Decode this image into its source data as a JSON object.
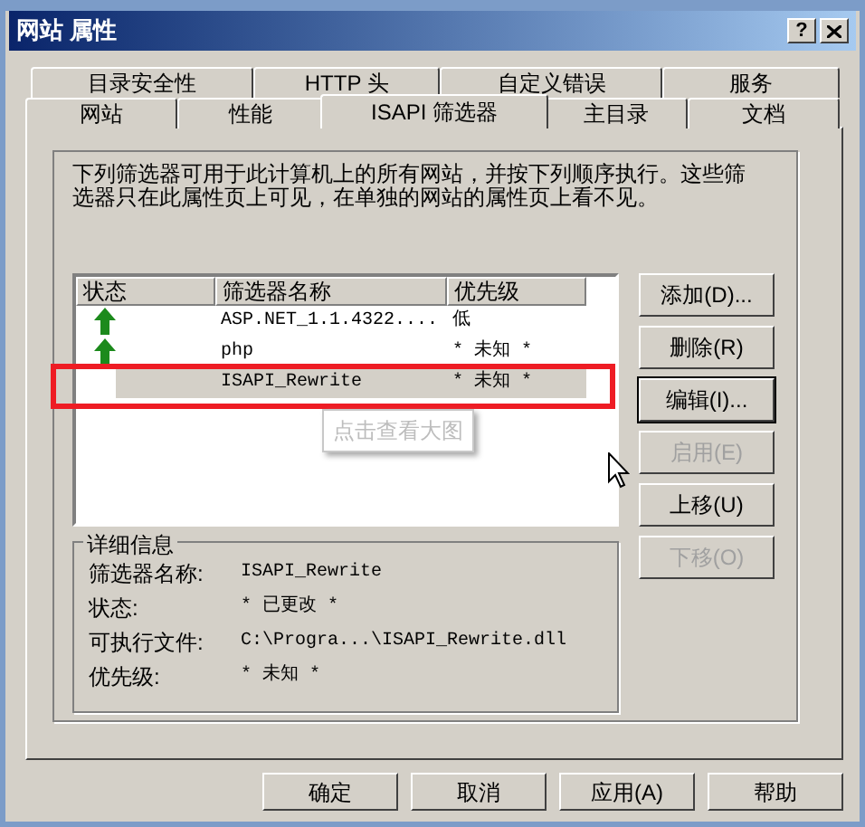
{
  "window": {
    "title": "网站 属性",
    "help_button": "?"
  },
  "tabs_back": [
    {
      "label": "目录安全性",
      "selected": false
    },
    {
      "label": "HTTP 头",
      "selected": false
    },
    {
      "label": "自定义错误",
      "selected": false
    },
    {
      "label": "服务",
      "selected": false
    }
  ],
  "tabs_front": [
    {
      "label": "网站",
      "selected": false
    },
    {
      "label": "性能",
      "selected": false
    },
    {
      "label": "ISAPI 筛选器",
      "selected": true
    },
    {
      "label": "主目录",
      "selected": false
    },
    {
      "label": "文档",
      "selected": false
    }
  ],
  "description": "下列筛选器可用于此计算机上的所有网站，并按下列顺序执行。这些筛选器只在此属性页上可见，在单独的网站的属性页上看不见。",
  "filter_list": {
    "columns": [
      "状态",
      "筛选器名称",
      "优先级"
    ],
    "rows": [
      {
        "loaded": true,
        "name": "ASP.NET_1.1.4322....",
        "priority": "低",
        "selected": false
      },
      {
        "loaded": true,
        "name": "php",
        "priority": "* 未知 *",
        "selected": false
      },
      {
        "loaded": false,
        "name": "ISAPI_Rewrite",
        "priority": "* 未知 *",
        "selected": true
      }
    ]
  },
  "tooltip": "点击查看大图",
  "side_buttons": [
    {
      "label": "添加(D)...",
      "disabled": false,
      "focused": false
    },
    {
      "label": "删除(R)",
      "disabled": false,
      "focused": false
    },
    {
      "label": "编辑(I)...",
      "disabled": false,
      "focused": true
    },
    {
      "label": "启用(E)",
      "disabled": true,
      "focused": false
    },
    {
      "label": "上移(U)",
      "disabled": false,
      "focused": false
    },
    {
      "label": "下移(O)",
      "disabled": true,
      "focused": false
    }
  ],
  "details": {
    "title": "详细信息",
    "fields": [
      {
        "label": "筛选器名称:",
        "value": "ISAPI_Rewrite"
      },
      {
        "label": "状态:",
        "value": "* 已更改 *"
      },
      {
        "label": "可执行文件:",
        "value": "C:\\Progra...\\ISAPI_Rewrite.dll"
      },
      {
        "label": "优先级:",
        "value": "* 未知 *"
      }
    ]
  },
  "buttons": [
    {
      "label": "确定"
    },
    {
      "label": "取消"
    },
    {
      "label": "应用(A)"
    },
    {
      "label": "帮助"
    }
  ]
}
